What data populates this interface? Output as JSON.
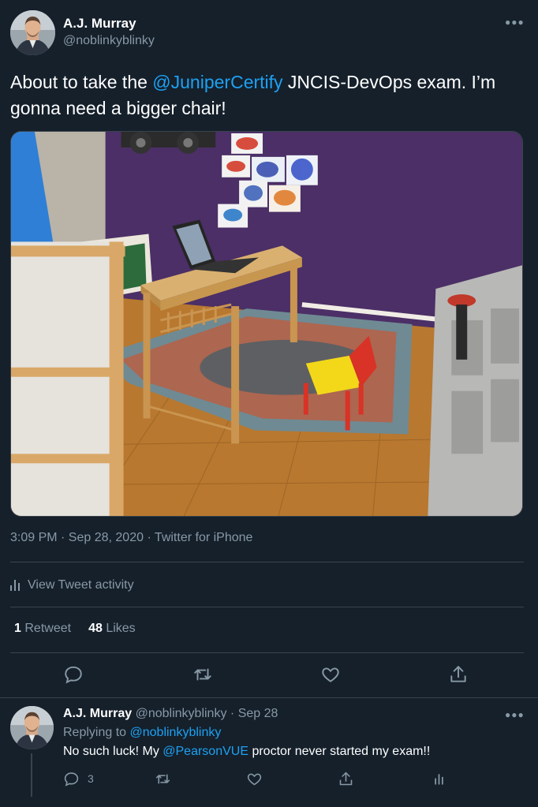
{
  "tweet": {
    "author_name": "A.J. Murray",
    "author_handle": "@noblinkyblinky",
    "more_icon": "more-icon",
    "text_before": "About to take the ",
    "mention": "@JuniperCertify",
    "text_after": " JNCIS-DevOps exam. I’m gonna need a bigger chair!",
    "meta": "3:09 PM · Sep 28, 2020 · Twitter for iPhone",
    "activity_label": "View Tweet activity",
    "retweets_count": "1",
    "retweets_label": "Retweet",
    "likes_count": "48",
    "likes_label": "Likes"
  },
  "reply": {
    "author_name": "A.J. Murray",
    "author_handle": "@noblinkyblinky",
    "separator": "·",
    "date": "Sep 28",
    "replying_prefix": "Replying to",
    "replying_handle": "@noblinkyblinky",
    "text_before": "No such luck! My ",
    "mention": "@PearsonVUE",
    "text_after": " proctor never started my exam!!",
    "reply_count": "3"
  },
  "icons": [
    "reply-icon",
    "retweet-icon",
    "like-icon",
    "share-icon",
    "analytics-icon"
  ],
  "colors": {
    "background": "#15202b",
    "border": "#38444d",
    "secondary_text": "#8899a6",
    "accent": "#1da1f2",
    "wall": "#4b2f66",
    "floor": "#b8782f"
  }
}
